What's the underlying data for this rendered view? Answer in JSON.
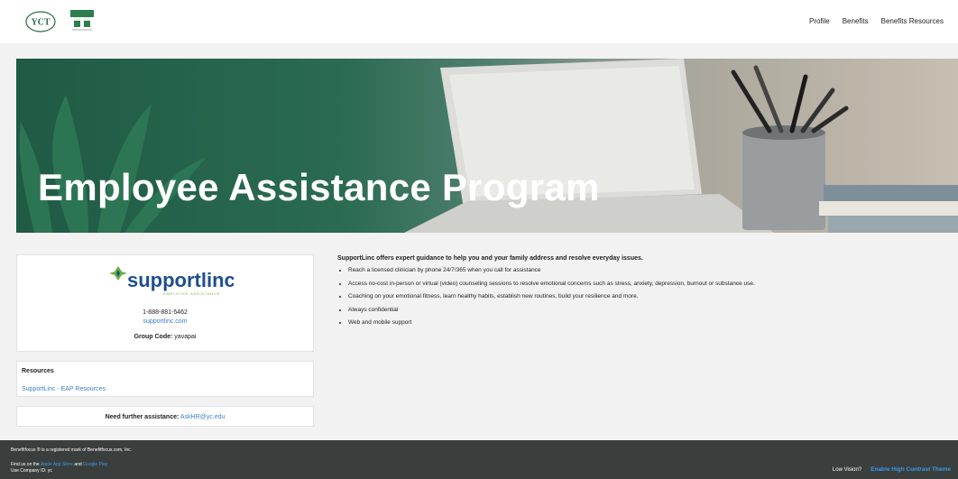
{
  "header": {
    "logo_left_text": "YCT",
    "nav": [
      "Profile",
      "Benefits",
      "Benefits Resources"
    ]
  },
  "hero": {
    "title": "Employee Assistance Program"
  },
  "support_card": {
    "brand": "supportlinc",
    "tagline": "EMPLOYEE ASSISTANCE",
    "phone": "1-888-881-5462",
    "website": "supportlinc.com",
    "group_code_label": "Group Code:",
    "group_code_value": "yavapai"
  },
  "resources": {
    "title": "Resources",
    "link": "SupportLinc - EAP Resources"
  },
  "assistance": {
    "label": "Need further assistance:",
    "email": "AskHR@yc.edu"
  },
  "content": {
    "intro": "SupportLinc offers expert guidance to help you and your family address and resolve everyday issues.",
    "bullets": [
      "Reach a licensed clinician by phone 24/7/365 when you call for assistance",
      "Access no-cost in-person or virtual (video) counseling sessions to resolve emotional concerns such as stress, anxiety, depression, burnout or substance use.",
      "Coaching on your emotional fitness, learn healthy habits, establish new routines, build your resilience and more.",
      "Always confidential",
      "Web and mobile support"
    ]
  },
  "footer": {
    "trademark": "Benefitfocus ® is a registered mark of Benefitfocus.com, Inc.",
    "find_us": "Find us on the",
    "app_store": "Apple App Store",
    "and": "and",
    "google_play": "Google Play",
    "company_id": "Use Company ID: yc",
    "low_vision": "Low Vision?",
    "high_contrast": "Enable High Contrast Theme"
  },
  "colors": {
    "link": "#3b7fc4",
    "footer_bg": "#3a3e3d",
    "footer_link": "#3b9be6",
    "brand_blue": "#1f4f8f",
    "brand_green": "#6cb33f"
  }
}
